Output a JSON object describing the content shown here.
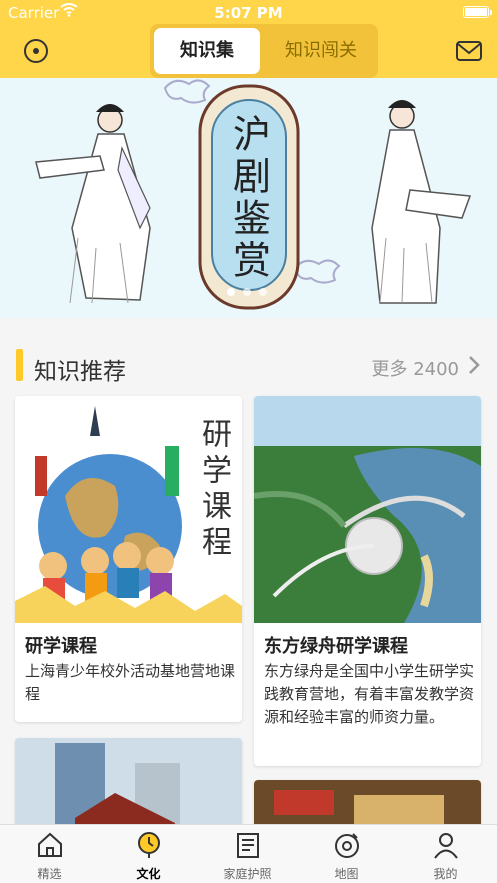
{
  "statusbar": {
    "carrier": "Carrier",
    "time": "5:07 PM"
  },
  "header": {
    "tabs": [
      "知识集",
      "知识闯关"
    ],
    "active_tab_index": 0
  },
  "banner": {
    "title": "沪剧鉴赏",
    "slide_count": 3,
    "active_slide_index": 0
  },
  "section": {
    "title": "知识推荐",
    "more_label": "更多 2400"
  },
  "cards": [
    {
      "title": "研学课程",
      "desc": "上海青少年校外活动基地营地课程",
      "thumb_text": "研学课程"
    },
    {
      "title": "东方绿舟研学课程",
      "desc": "东方绿舟是全国中小学生研学实践教育营地，有着丰富发教学资源和经验丰富的师资力量。"
    }
  ],
  "tabbar": {
    "items": [
      {
        "label": "精选",
        "icon": "home-icon"
      },
      {
        "label": "文化",
        "icon": "culture-icon"
      },
      {
        "label": "家庭护照",
        "icon": "passport-icon"
      },
      {
        "label": "地图",
        "icon": "map-icon"
      },
      {
        "label": "我的",
        "icon": "profile-icon"
      }
    ],
    "active_index": 1
  },
  "colors": {
    "accent": "#ffd54a",
    "accent_dark": "#f2c23a",
    "tabbar_active": "#ffc928"
  }
}
